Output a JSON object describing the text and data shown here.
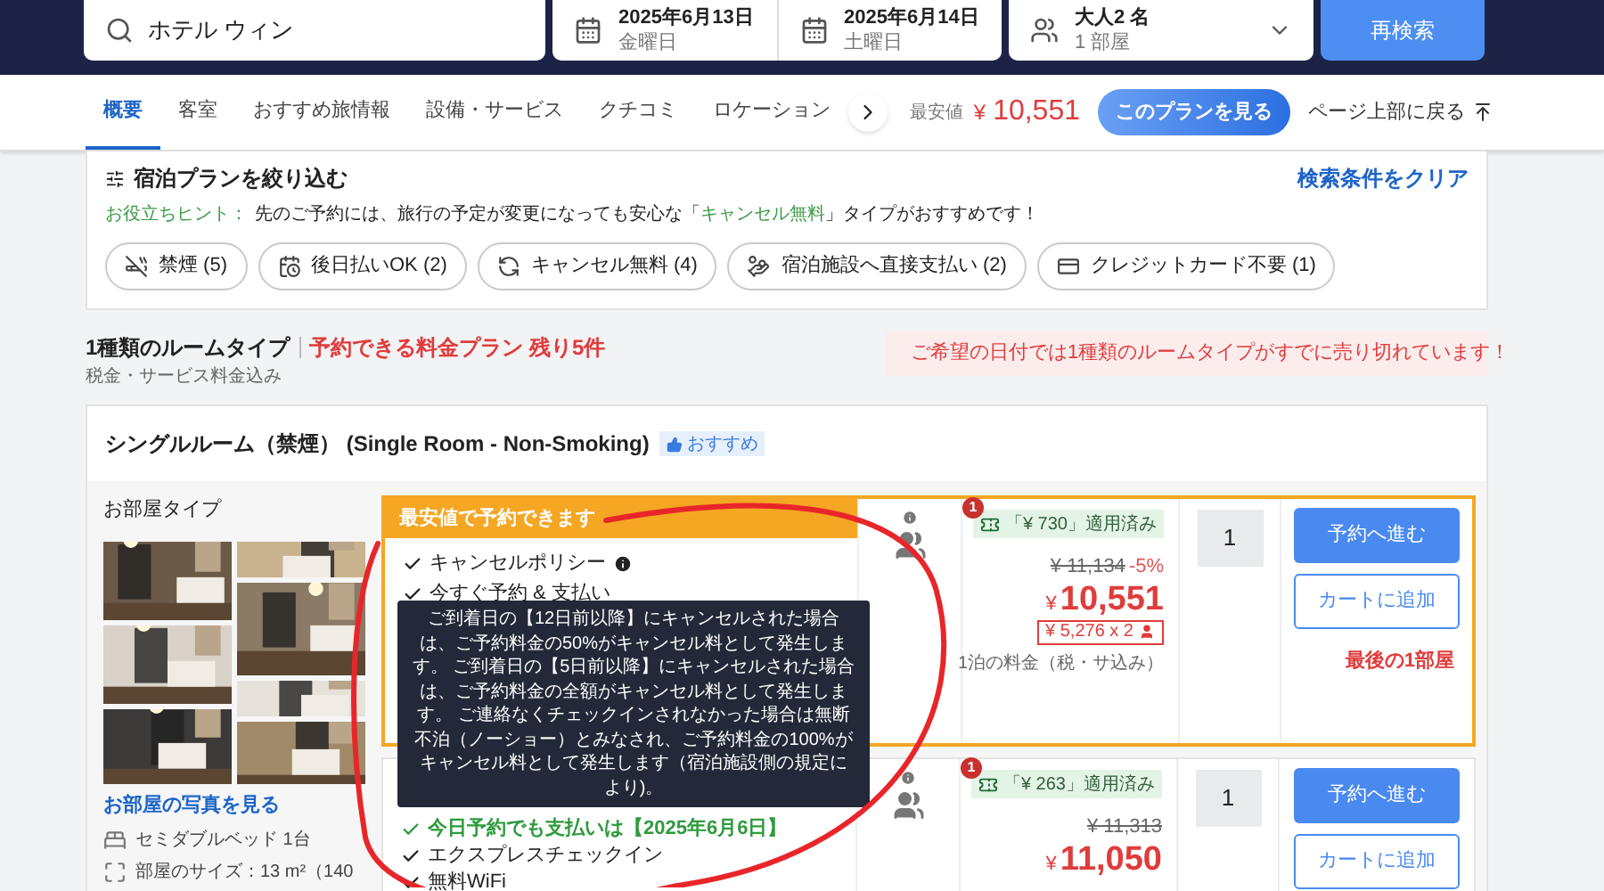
{
  "search": {
    "query": "ホテル ウィン",
    "checkin": {
      "date": "2025年6月13日",
      "weekday": "金曜日"
    },
    "checkout": {
      "date": "2025年6月14日",
      "weekday": "土曜日"
    },
    "guests": {
      "adults": "大人2 名",
      "rooms": "1 部屋"
    },
    "button": "再検索"
  },
  "tabs": [
    {
      "label": "概要",
      "selected": true
    },
    {
      "label": "客室",
      "selected": false
    },
    {
      "label": "おすすめ旅情報",
      "selected": false
    },
    {
      "label": "設備・サービス",
      "selected": false
    },
    {
      "label": "クチコミ",
      "selected": false
    },
    {
      "label": "ロケーション",
      "selected": false
    }
  ],
  "price_bar": {
    "label": "最安値",
    "currency": "¥",
    "price": "10,551",
    "button": "このプランを見る",
    "back_to_top": "ページ上部に戻る"
  },
  "filter": {
    "title": "宿泊プランを絞り込む",
    "clear": "検索条件をクリア",
    "hint_label": "お役立ちヒント：",
    "hint_before": "先のご予約には、旅行の予定が変更になっても安心な「",
    "hint_highlight": "キャンセル無料",
    "hint_after": "」タイプがおすすめです！",
    "chips": [
      {
        "kind": "nosmoking",
        "label": "禁煙 (5)"
      },
      {
        "kind": "paylater",
        "label": "後日払いOK (2)"
      },
      {
        "kind": "cancel",
        "label": "キャンセル無料 (4)"
      },
      {
        "kind": "payhotel",
        "label": "宿泊施設へ直接支払い (2)"
      },
      {
        "kind": "nocard",
        "label": "クレジットカード不要 (1)"
      }
    ]
  },
  "summary": {
    "room_types": "1種類のルームタイプ",
    "plans": "予約できる料金プラン 残り5件",
    "tax_note": "税金・サービス料金込み",
    "alert": "ご希望の日付では1種類のルームタイプがすでに売り切れています！"
  },
  "room": {
    "name": "シングルルーム（禁煙） (Single Room - Non-Smoking)",
    "badge": "おすすめ",
    "type_label": "お部屋タイプ",
    "photos_link": "お部屋の写真を見る",
    "facts": [
      {
        "kind": "bed",
        "text": "セミダブルベッド 1台"
      },
      {
        "kind": "size",
        "text": "部屋のサイズ：13 m²（140"
      }
    ],
    "plans": [
      {
        "header": "最安値で予約できます",
        "highlighted": true,
        "features": [
          {
            "text": "キャンセルポリシー",
            "info": true,
            "emphasis": false
          },
          {
            "text": "今すぐ予約 & 支払い",
            "info": false,
            "emphasis": false
          }
        ],
        "badge": "1",
        "discount": "「¥ 730」適用済み",
        "original_price": "¥ 11,134",
        "discount_rate": "-5%",
        "currency": "¥",
        "price": "10,551",
        "per_person": "¥ 5,276 x 2",
        "price_note": "1泊の料金（税・サ込み）",
        "quantity": "1",
        "book": "予約へ進む",
        "cart": "カートに追加",
        "stock_note": "最後の1部屋"
      },
      {
        "highlighted": false,
        "features": [
          {
            "text": "今日予約でも支払いは【2025年6月6日】",
            "info": false,
            "emphasis": true
          },
          {
            "text": "エクスプレスチェックイン",
            "info": false,
            "emphasis": false
          },
          {
            "text": "無料WiFi",
            "info": false,
            "emphasis": false
          }
        ],
        "badge": "1",
        "discount": "「¥ 263」適用済み",
        "original_price": "¥ 11,313",
        "currency": "¥",
        "price": "11,050",
        "quantity": "1",
        "book": "予約へ進む",
        "cart": "カートに追加"
      }
    ]
  },
  "tooltip": "ご到着日の【12日前以降】にキャンセルされた場合は、ご予約料金の50%がキャンセル料として発生します。 ご到着日の【5日前以降】にキャンセルされた場合は、ご予約料金の全額がキャンセル料として発生します。 ご連絡なくチェックインされなかった場合は無断不泊（ノーショー）とみなされ、ご予約料金の100%がキャンセル料として発生します（宿泊施設側の規定により)。"
}
